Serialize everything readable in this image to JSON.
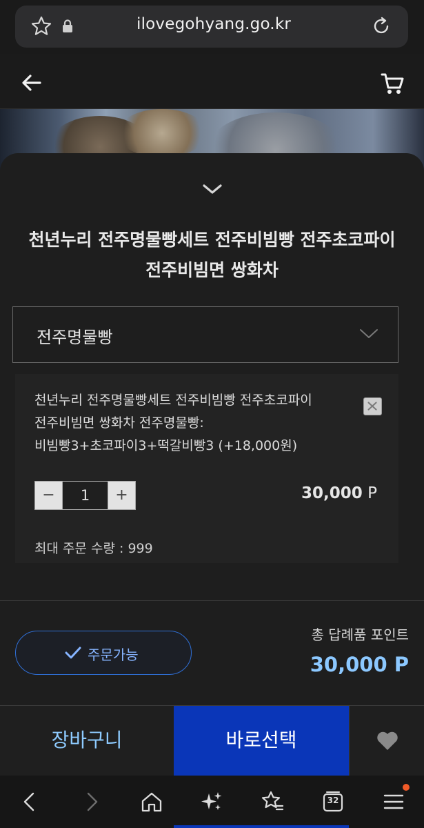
{
  "browser": {
    "url": "ilovegohyang.go.kr"
  },
  "product": {
    "title_line1": "천년누리 전주명물빵세트 전주비빔빵 전주초코파이",
    "title_line2": "전주비빔면 쌍화차",
    "option_select_value": "전주명물빵"
  },
  "selected_item": {
    "name_line1": "천년누리 전주명물빵세트 전주비빔빵 전주초코파이",
    "name_line2": "전주비빔면 쌍화차 전주명물빵:",
    "name_line3": "비빔빵3+초코파이3+떡갈비빵3 (+18,000원)",
    "quantity": "1",
    "minus": "−",
    "plus": "+",
    "price": "30,000",
    "price_unit": "P",
    "max_qty": "최대 주문 수량 : 999"
  },
  "order": {
    "status_label": "주문가능",
    "total_label": "총 답례품 포인트",
    "total_value": "30,000 P"
  },
  "actions": {
    "cart_label": "장바구니",
    "buy_label": "바로선택"
  },
  "nav": {
    "tabs_count": "32"
  },
  "colors": {
    "accent_blue": "#0a36b8",
    "link_blue": "#8ecbff",
    "background": "#1e1e1e"
  },
  "icons": [
    "star-icon",
    "lock-icon",
    "refresh-icon",
    "back-arrow-icon",
    "cart-icon",
    "chevron-down-icon",
    "close-icon",
    "check-icon",
    "heart-icon",
    "nav-back-icon",
    "nav-forward-icon",
    "home-icon",
    "sparkle-icon",
    "bookmarks-icon",
    "tabs-icon",
    "menu-icon"
  ]
}
